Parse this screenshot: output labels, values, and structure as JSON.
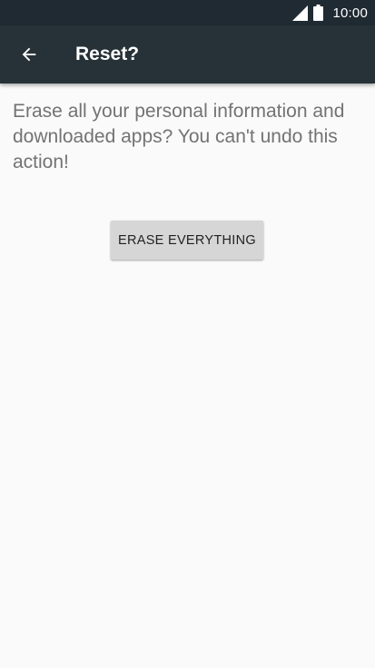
{
  "status_bar": {
    "time": "10:00",
    "signal_icon": "cellular-signal-icon",
    "battery_icon": "battery-icon"
  },
  "app_bar": {
    "back_icon": "arrow-back-icon",
    "title": "Reset?"
  },
  "content": {
    "message": "Erase all your personal information and downloaded apps? You can't undo this action!",
    "erase_button_label": "ERASE EVERYTHING"
  },
  "colors": {
    "status_bar_bg": "#1f2a32",
    "app_bar_bg": "#263238",
    "page_bg": "#fafafa",
    "message_text": "#737373",
    "button_bg": "#d6d6d6"
  }
}
